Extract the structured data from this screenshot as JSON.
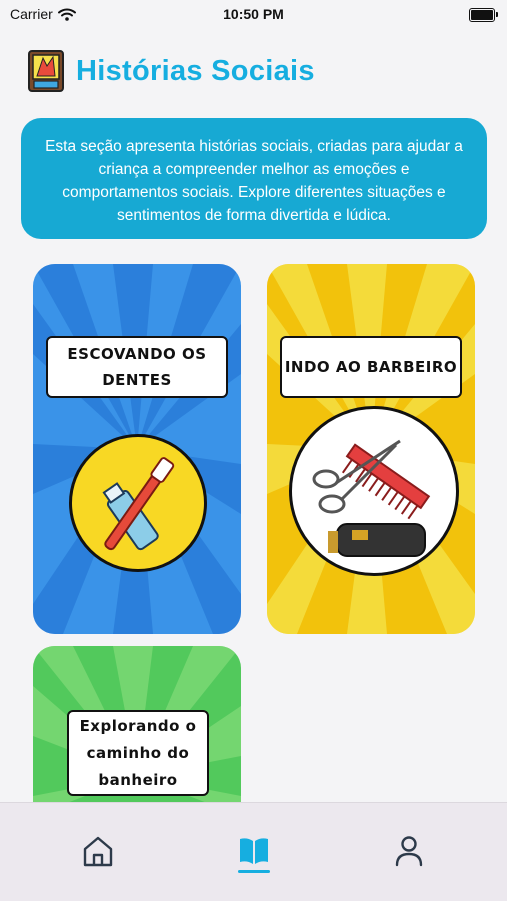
{
  "status_bar": {
    "carrier": "Carrier",
    "time": "10:50 PM"
  },
  "header": {
    "title": "Histórias Sociais",
    "icon": "storybook-app-icon"
  },
  "banner": {
    "text": "Esta seção apresenta histórias sociais, criadas para ajudar a criança a compreender melhor as emoções e comportamentos sociais. Explore diferentes situações e sentimentos de forma divertida e lúdica."
  },
  "cards": [
    {
      "label": "ESCOVANDO OS DENTES",
      "icon": "toothbrush-icon",
      "color": "#3a93e8"
    },
    {
      "label": "INDO AO BARBEIRO",
      "icon": "barber-tools-icon",
      "color": "#f2c20c"
    },
    {
      "label": "Explorando o caminho do banheiro",
      "color": "#52c95c"
    }
  ],
  "tab_bar": {
    "items": [
      {
        "icon": "home-icon",
        "active": false
      },
      {
        "icon": "book-icon",
        "active": true
      },
      {
        "icon": "person-icon",
        "active": false
      }
    ],
    "active_color": "#16aee0"
  }
}
